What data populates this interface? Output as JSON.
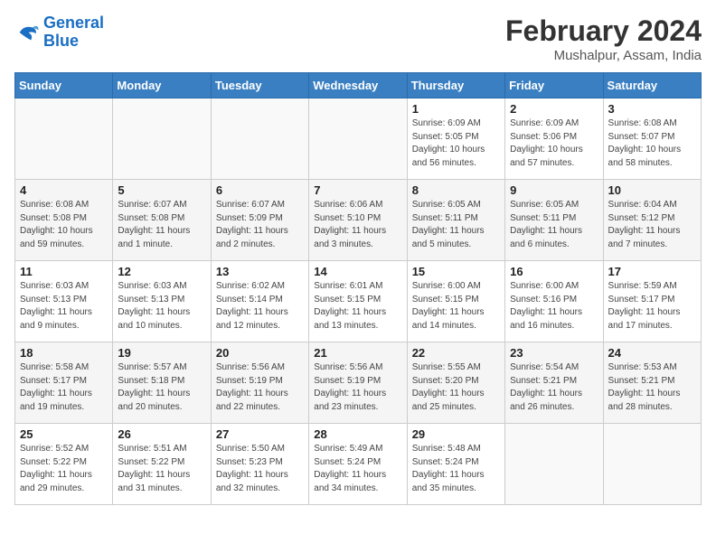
{
  "logo": {
    "line1": "General",
    "line2": "Blue"
  },
  "title": {
    "month_year": "February 2024",
    "location": "Mushalpur, Assam, India"
  },
  "days_of_week": [
    "Sunday",
    "Monday",
    "Tuesday",
    "Wednesday",
    "Thursday",
    "Friday",
    "Saturday"
  ],
  "weeks": [
    [
      {
        "day": "",
        "info": ""
      },
      {
        "day": "",
        "info": ""
      },
      {
        "day": "",
        "info": ""
      },
      {
        "day": "",
        "info": ""
      },
      {
        "day": "1",
        "info": "Sunrise: 6:09 AM\nSunset: 5:05 PM\nDaylight: 10 hours\nand 56 minutes."
      },
      {
        "day": "2",
        "info": "Sunrise: 6:09 AM\nSunset: 5:06 PM\nDaylight: 10 hours\nand 57 minutes."
      },
      {
        "day": "3",
        "info": "Sunrise: 6:08 AM\nSunset: 5:07 PM\nDaylight: 10 hours\nand 58 minutes."
      }
    ],
    [
      {
        "day": "4",
        "info": "Sunrise: 6:08 AM\nSunset: 5:08 PM\nDaylight: 10 hours\nand 59 minutes."
      },
      {
        "day": "5",
        "info": "Sunrise: 6:07 AM\nSunset: 5:08 PM\nDaylight: 11 hours\nand 1 minute."
      },
      {
        "day": "6",
        "info": "Sunrise: 6:07 AM\nSunset: 5:09 PM\nDaylight: 11 hours\nand 2 minutes."
      },
      {
        "day": "7",
        "info": "Sunrise: 6:06 AM\nSunset: 5:10 PM\nDaylight: 11 hours\nand 3 minutes."
      },
      {
        "day": "8",
        "info": "Sunrise: 6:05 AM\nSunset: 5:11 PM\nDaylight: 11 hours\nand 5 minutes."
      },
      {
        "day": "9",
        "info": "Sunrise: 6:05 AM\nSunset: 5:11 PM\nDaylight: 11 hours\nand 6 minutes."
      },
      {
        "day": "10",
        "info": "Sunrise: 6:04 AM\nSunset: 5:12 PM\nDaylight: 11 hours\nand 7 minutes."
      }
    ],
    [
      {
        "day": "11",
        "info": "Sunrise: 6:03 AM\nSunset: 5:13 PM\nDaylight: 11 hours\nand 9 minutes."
      },
      {
        "day": "12",
        "info": "Sunrise: 6:03 AM\nSunset: 5:13 PM\nDaylight: 11 hours\nand 10 minutes."
      },
      {
        "day": "13",
        "info": "Sunrise: 6:02 AM\nSunset: 5:14 PM\nDaylight: 11 hours\nand 12 minutes."
      },
      {
        "day": "14",
        "info": "Sunrise: 6:01 AM\nSunset: 5:15 PM\nDaylight: 11 hours\nand 13 minutes."
      },
      {
        "day": "15",
        "info": "Sunrise: 6:00 AM\nSunset: 5:15 PM\nDaylight: 11 hours\nand 14 minutes."
      },
      {
        "day": "16",
        "info": "Sunrise: 6:00 AM\nSunset: 5:16 PM\nDaylight: 11 hours\nand 16 minutes."
      },
      {
        "day": "17",
        "info": "Sunrise: 5:59 AM\nSunset: 5:17 PM\nDaylight: 11 hours\nand 17 minutes."
      }
    ],
    [
      {
        "day": "18",
        "info": "Sunrise: 5:58 AM\nSunset: 5:17 PM\nDaylight: 11 hours\nand 19 minutes."
      },
      {
        "day": "19",
        "info": "Sunrise: 5:57 AM\nSunset: 5:18 PM\nDaylight: 11 hours\nand 20 minutes."
      },
      {
        "day": "20",
        "info": "Sunrise: 5:56 AM\nSunset: 5:19 PM\nDaylight: 11 hours\nand 22 minutes."
      },
      {
        "day": "21",
        "info": "Sunrise: 5:56 AM\nSunset: 5:19 PM\nDaylight: 11 hours\nand 23 minutes."
      },
      {
        "day": "22",
        "info": "Sunrise: 5:55 AM\nSunset: 5:20 PM\nDaylight: 11 hours\nand 25 minutes."
      },
      {
        "day": "23",
        "info": "Sunrise: 5:54 AM\nSunset: 5:21 PM\nDaylight: 11 hours\nand 26 minutes."
      },
      {
        "day": "24",
        "info": "Sunrise: 5:53 AM\nSunset: 5:21 PM\nDaylight: 11 hours\nand 28 minutes."
      }
    ],
    [
      {
        "day": "25",
        "info": "Sunrise: 5:52 AM\nSunset: 5:22 PM\nDaylight: 11 hours\nand 29 minutes."
      },
      {
        "day": "26",
        "info": "Sunrise: 5:51 AM\nSunset: 5:22 PM\nDaylight: 11 hours\nand 31 minutes."
      },
      {
        "day": "27",
        "info": "Sunrise: 5:50 AM\nSunset: 5:23 PM\nDaylight: 11 hours\nand 32 minutes."
      },
      {
        "day": "28",
        "info": "Sunrise: 5:49 AM\nSunset: 5:24 PM\nDaylight: 11 hours\nand 34 minutes."
      },
      {
        "day": "29",
        "info": "Sunrise: 5:48 AM\nSunset: 5:24 PM\nDaylight: 11 hours\nand 35 minutes."
      },
      {
        "day": "",
        "info": ""
      },
      {
        "day": "",
        "info": ""
      }
    ]
  ]
}
